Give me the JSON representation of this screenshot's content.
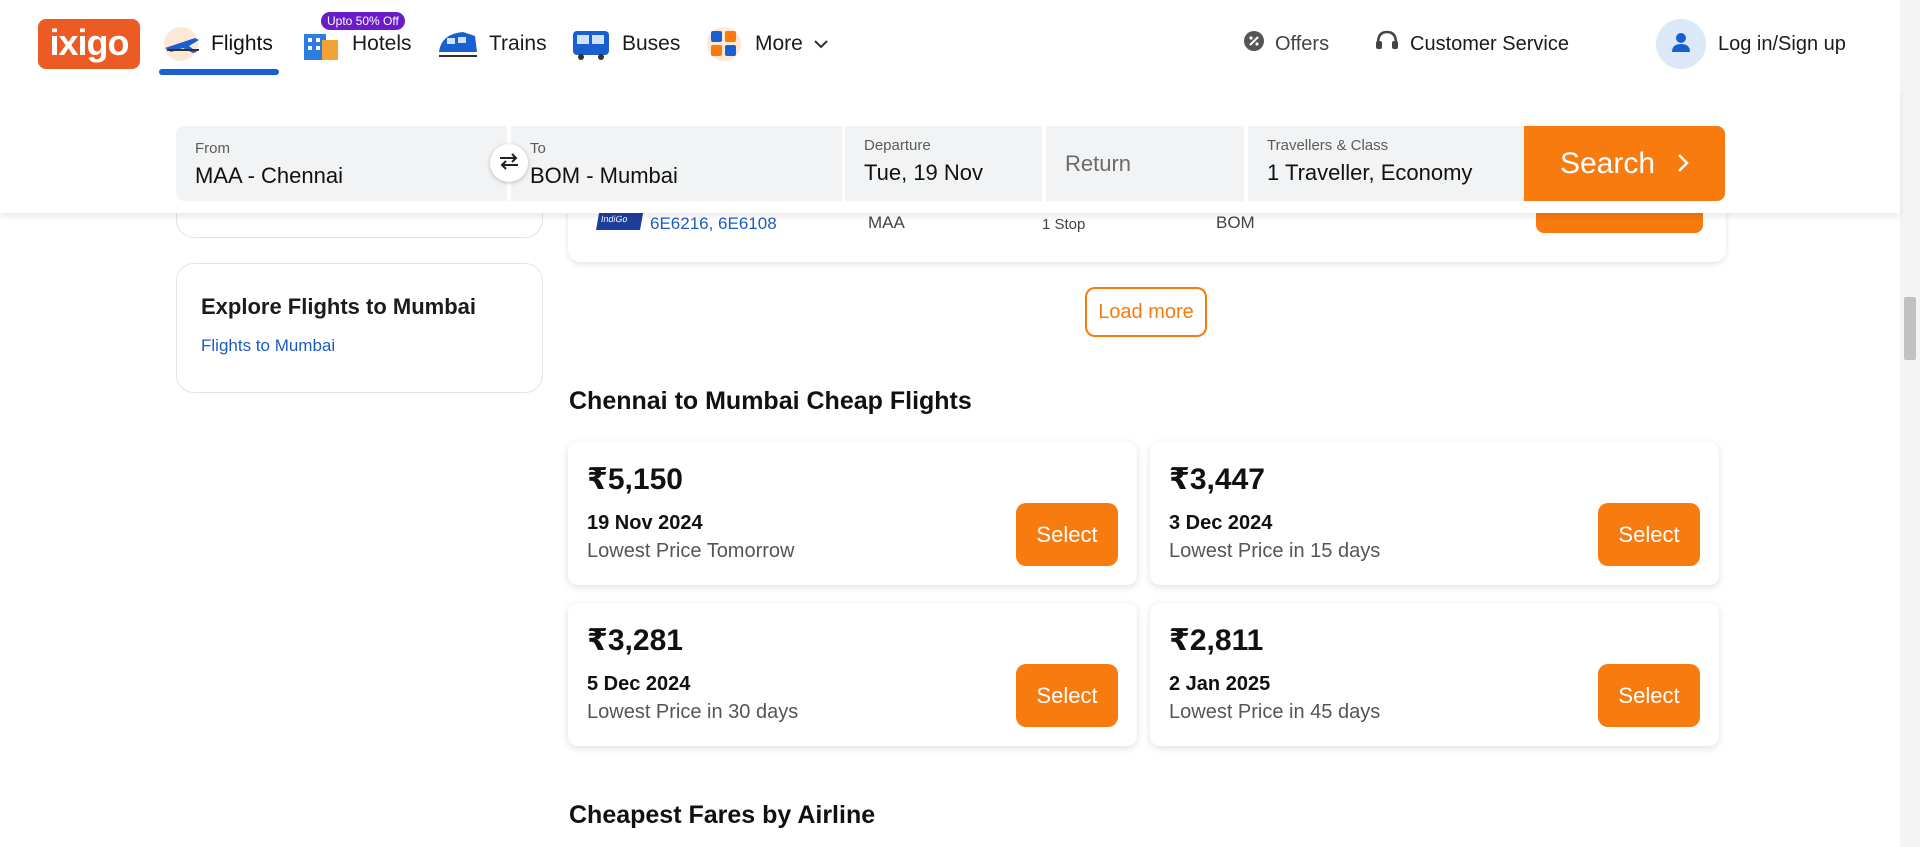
{
  "brand": {
    "logo_text": "ixigo",
    "accent": "#f77b0f",
    "logo_bg": "#ec5b24"
  },
  "nav": {
    "items": [
      {
        "label": "Flights",
        "icon": "plane-icon",
        "active": true
      },
      {
        "label": "Hotels",
        "icon": "hotel-icon",
        "badge": "Upto 50% Off"
      },
      {
        "label": "Trains",
        "icon": "train-icon"
      },
      {
        "label": "Buses",
        "icon": "bus-icon"
      },
      {
        "label": "More",
        "icon": "grid-icon"
      }
    ],
    "offers_label": "Offers",
    "customer_service_label": "Customer Service",
    "login_label": "Log in/Sign up"
  },
  "search": {
    "from_label": "From",
    "from_value": "MAA - Chennai",
    "to_label": "To",
    "to_value": "BOM - Mumbai",
    "departure_label": "Departure",
    "departure_value": "Tue, 19 Nov",
    "return_placeholder": "Return",
    "travellers_label": "Travellers & Class",
    "travellers_value": "1 Traveller, Economy",
    "search_label": "Search"
  },
  "flight_row": {
    "airline_logo_text": "IndiGo",
    "flight_numbers": "6E6216, 6E6108",
    "from": "MAA",
    "stops": "1 Stop",
    "to": "BOM"
  },
  "sidebar": {
    "explore_title": "Explore Flights to Mumbai",
    "explore_link": "Flights to Mumbai"
  },
  "load_more_label": "Load more",
  "cheap_flights": {
    "title": "Chennai to Mumbai Cheap Flights",
    "cards": [
      {
        "price": "₹5,150",
        "date": "19 Nov 2024",
        "note": "Lowest Price Tomorrow",
        "button": "Select"
      },
      {
        "price": "₹3,447",
        "date": "3 Dec 2024",
        "note": "Lowest Price in 15 days",
        "button": "Select"
      },
      {
        "price": "₹3,281",
        "date": "5 Dec 2024",
        "note": "Lowest Price in 30 days",
        "button": "Select"
      },
      {
        "price": "₹2,811",
        "date": "2 Jan 2025",
        "note": "Lowest Price in 45 days",
        "button": "Select"
      }
    ]
  },
  "airline_section_title": "Cheapest Fares by Airline"
}
